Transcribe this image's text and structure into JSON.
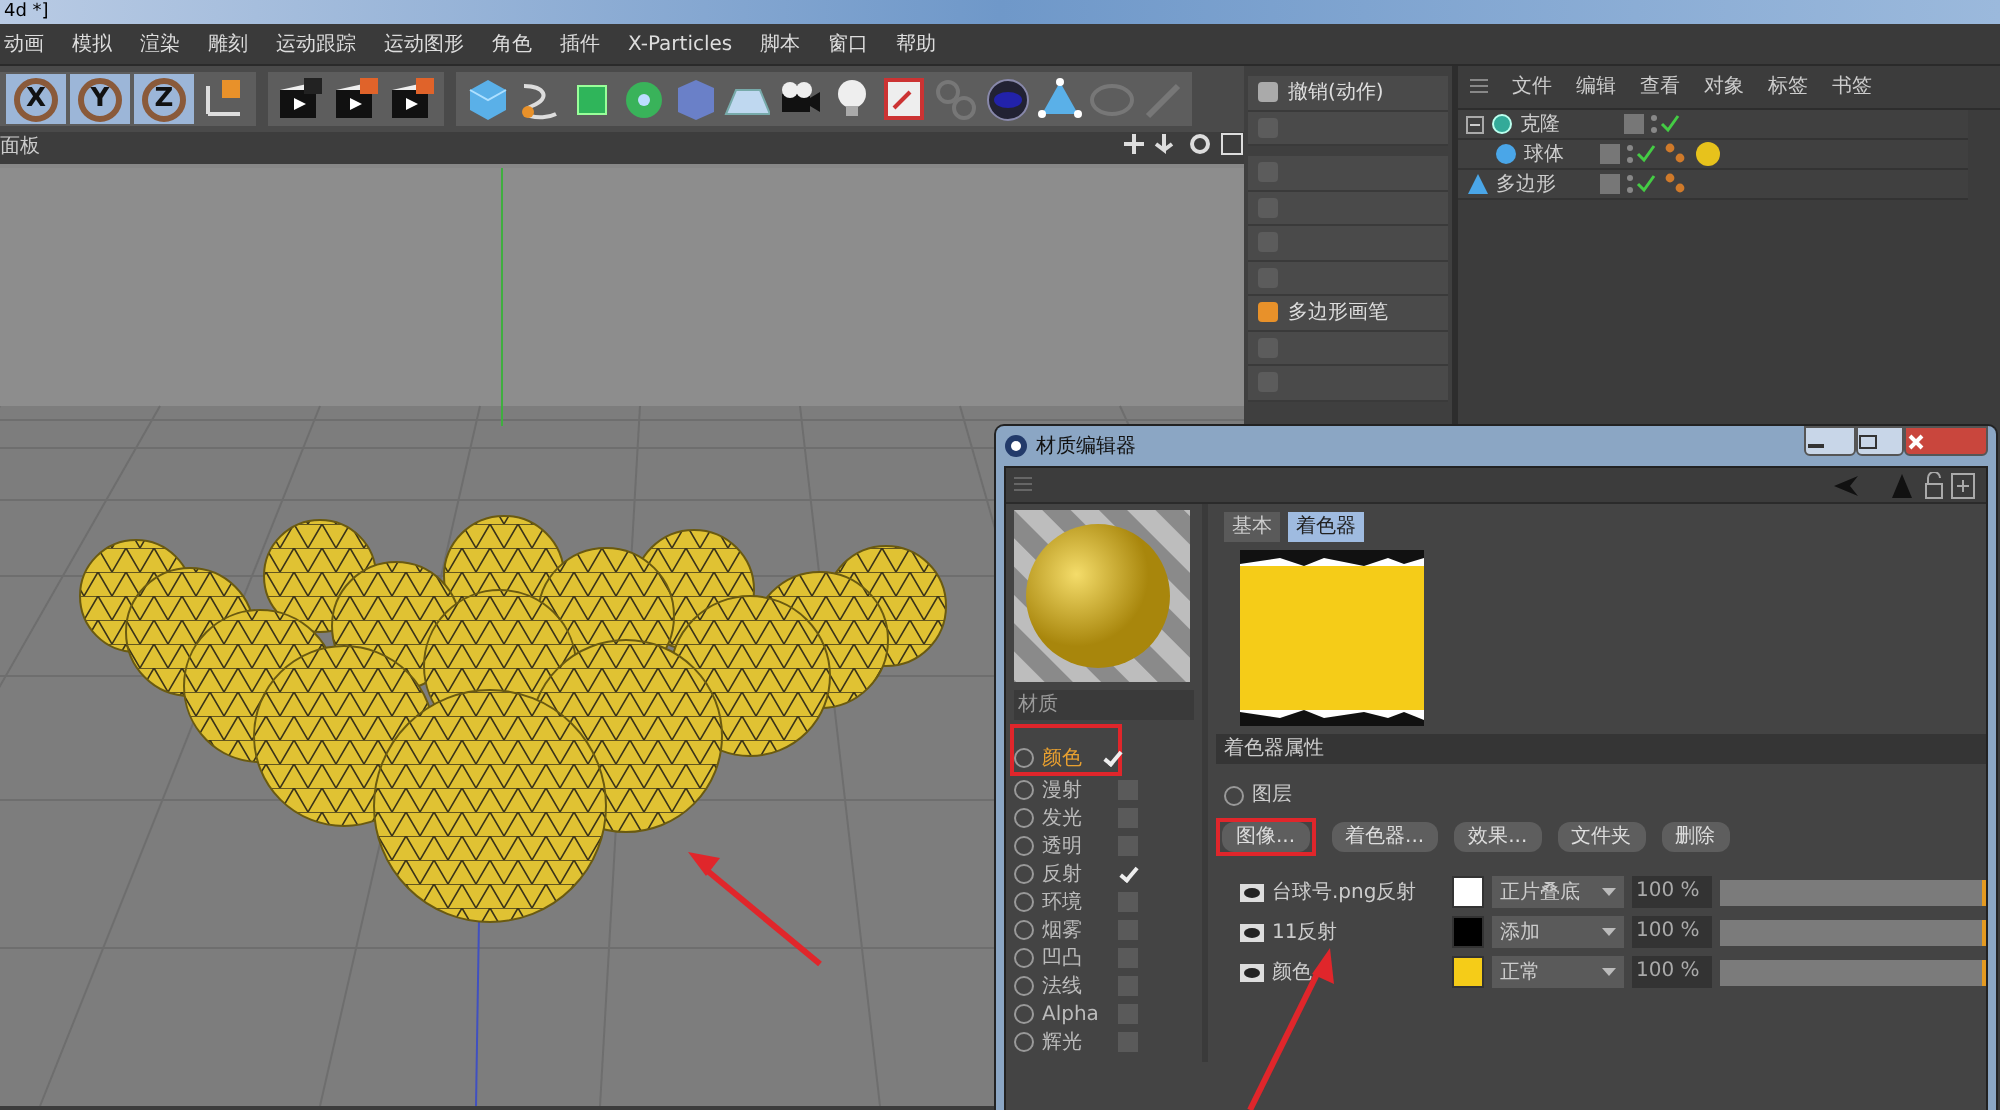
{
  "window": {
    "title": "4d *]"
  },
  "menu": [
    "动画",
    "模拟",
    "渲染",
    "雕刻",
    "运动跟踪",
    "运动图形",
    "角色",
    "插件",
    "X-Particles",
    "脚本",
    "窗口",
    "帮助"
  ],
  "toolbar": {
    "axes": [
      {
        "label": "X",
        "selected": true
      },
      {
        "label": "Y",
        "selected": true
      },
      {
        "label": "Z",
        "selected": true
      }
    ]
  },
  "viewport": {
    "title": "面板"
  },
  "commands": [
    {
      "label": "撤销(动作)",
      "disabled": false
    },
    {
      "disabled": true
    },
    {
      "disabled": true
    },
    {
      "disabled": true
    },
    {
      "disabled": true
    },
    {
      "disabled": true
    },
    {
      "label": "多边形画笔",
      "disabled": false
    },
    {
      "disabled": true
    },
    {
      "disabled": true
    }
  ],
  "objects": {
    "menu": [
      "文件",
      "编辑",
      "查看",
      "对象",
      "标签",
      "书签"
    ],
    "tree": [
      {
        "name": "克隆",
        "kind": "cloner",
        "expanded": true,
        "children": [
          {
            "name": "球体",
            "kind": "sphere"
          }
        ]
      },
      {
        "name": "多边形",
        "kind": "polygon"
      }
    ]
  },
  "material_editor": {
    "title": "材质编辑器",
    "tabs": [
      {
        "label": "基本",
        "selected": false
      },
      {
        "label": "着色器",
        "selected": true
      }
    ],
    "name": "材质",
    "channels": [
      {
        "label": "颜色",
        "checked": true,
        "selected": true
      },
      {
        "label": "漫射",
        "checked": false,
        "selected": false
      },
      {
        "label": "发光",
        "checked": false,
        "selected": false
      },
      {
        "label": "透明",
        "checked": false,
        "selected": false
      },
      {
        "label": "反射",
        "checked": true,
        "selected": false
      },
      {
        "label": "环境",
        "checked": false,
        "selected": false
      },
      {
        "label": "烟雾",
        "checked": false,
        "selected": false
      },
      {
        "label": "凹凸",
        "checked": false,
        "selected": false
      },
      {
        "label": "法线",
        "checked": false,
        "selected": false
      },
      {
        "label": "Alpha",
        "checked": false,
        "selected": false
      },
      {
        "label": "辉光",
        "checked": false,
        "selected": false
      }
    ],
    "section": "着色器属性",
    "mode": "图层",
    "buttons": [
      "图像...",
      "着色器...",
      "效果...",
      "文件夹",
      "删除"
    ],
    "layers": [
      {
        "name": "台球号.png反射",
        "color": "#ffffff",
        "blend": "正片叠底",
        "opacity": "100 %",
        "level": 1
      },
      {
        "name": "11反射",
        "color": "#000000",
        "blend": "添加",
        "opacity": "100 %",
        "level": 1
      },
      {
        "name": "颜色",
        "color": "#f5cc18",
        "blend": "正常",
        "opacity": "100 %",
        "level": 1
      }
    ]
  }
}
